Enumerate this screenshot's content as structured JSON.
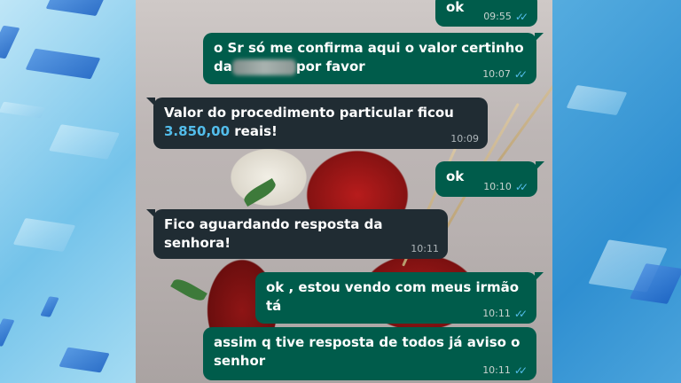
{
  "messages": [
    {
      "id": "m1",
      "direction": "out",
      "text": "ok",
      "time": "09:55",
      "status_icon": "double-check-read"
    },
    {
      "id": "m2",
      "direction": "out",
      "text_line1": "o Sr só me confirma aqui o valor certinho",
      "text_line2_prefix": "da",
      "text_line2_suffix": "por favor",
      "redacted": true,
      "time": "10:07",
      "status_icon": "double-check-read"
    },
    {
      "id": "m3",
      "direction": "in",
      "text_line1": "Valor do procedimento particular ficou",
      "price": "3.850,00",
      "text_line2_suffix": " reais!",
      "time": "10:09"
    },
    {
      "id": "m4",
      "direction": "out",
      "text": "ok",
      "time": "10:10",
      "status_icon": "double-check-read"
    },
    {
      "id": "m5",
      "direction": "in",
      "text": "Fico aguardando resposta da senhora!",
      "time": "10:11"
    },
    {
      "id": "m6",
      "direction": "out",
      "text": "ok , estou vendo com meus irmão tá",
      "time": "10:11",
      "status_icon": "double-check-read"
    },
    {
      "id": "m7",
      "direction": "out",
      "text_line1": "assim q tive resposta de todos já aviso o",
      "text_line2": "senhor",
      "time": "10:11",
      "status_icon": "double-check-read"
    }
  ],
  "colors": {
    "outgoing": "#005c4b",
    "incoming": "#202c33",
    "read_ticks": "#53bdeb",
    "link": "#53bdeb"
  }
}
